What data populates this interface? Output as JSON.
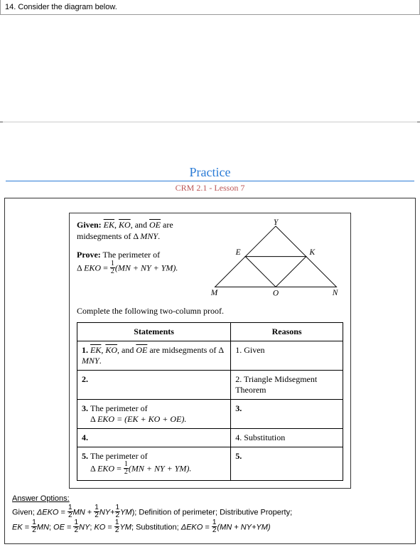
{
  "topItem": "14. Consider the diagram below.",
  "practiceTitle": "Practice",
  "lessonSub": "CRM 2.1 - Lesson 7",
  "given": {
    "label": "Given:",
    "seg1": "EK",
    "seg2": "KO",
    "seg3": "OE",
    "afterSegs": " are midsegments of Δ ",
    "tri": "MNY",
    "end": "."
  },
  "prove": {
    "label": "Prove:",
    "text": "  The perimeter of",
    "line2a": "Δ ",
    "line2tri": "EKO",
    "line2b": " = ",
    "fracN": "1",
    "fracD": "2",
    "line2c": "(MN + NY + YM)."
  },
  "diagramLabels": {
    "Y": "Y",
    "E": "E",
    "K": "K",
    "M": "M",
    "O": "O",
    "N": "N"
  },
  "completeLine": "Complete the following two-column proof.",
  "headers": {
    "stmt": "Statements",
    "reason": "Reasons"
  },
  "rows": [
    {
      "sNum": "1. ",
      "sSeg1": "EK",
      "sSeg2": "KO",
      "sSeg3": "OE",
      "sAfter": " are midsegments of Δ ",
      "sTri": "MNY",
      "sEnd": ".",
      "r": "1. Given"
    },
    {
      "sNum": "2.",
      "r": "2. Triangle Midsegment Theorem"
    },
    {
      "sNum": "3. ",
      "sText": "The perimeter of",
      "sLine2a": "Δ ",
      "sTri2": "EKO",
      "sLine2b": " = (EK + KO + OE).",
      "r": "3."
    },
    {
      "sNum": "4.",
      "r": "4. Substitution"
    },
    {
      "sNum": "5. ",
      "sText": "The perimeter of",
      "sLine2a": "Δ ",
      "sTri2": "EKO",
      "sLine2b": " = ",
      "fracN": "1",
      "fracD": "2",
      "sLine2c": "(MN + NY + YM).",
      "r": "5."
    }
  ],
  "answer": {
    "title": "Answer Options:",
    "line1a": "Given; ",
    "line1b": "ΔEKO",
    "line1c": " = ",
    "f1n": "1",
    "f1d": "2",
    "seg1": "MN",
    "plus1": " + ",
    "f2n": "1",
    "f2d": "2",
    "seg2": "NY",
    "plus2": "+",
    "f3n": "1",
    "f3d": "2",
    "seg3": "YM",
    "line1d": "); Definition of perimeter; Distributive Property;",
    "line2a": "EK",
    "eq1": " = ",
    "f4n": "1",
    "f4d": "2",
    "seg4": "MN",
    "sc1": "; ",
    "line2b": "OE",
    "eq2": " = ",
    "f5n": "1",
    "f5d": "2",
    "seg5": "NY",
    "sc2": "; ",
    "line2c": "KO",
    "eq3": " = ",
    "f6n": "1",
    "f6d": "2",
    "seg6": "YM",
    "sc3": "; Substitution; ",
    "line2d": "ΔEKO",
    "eq4": " = ",
    "f7n": "1",
    "f7d": "2",
    "line2e": "(MN + NY+YM)"
  }
}
